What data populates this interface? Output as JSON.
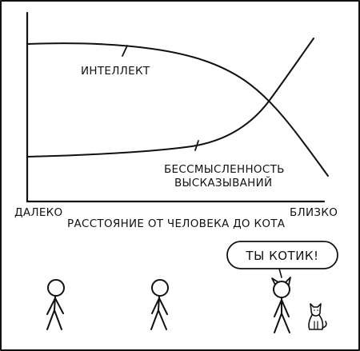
{
  "graph": {
    "curve_top_label": "ИНТЕЛЛЕКТ",
    "curve_bottom_label_line1": "БЕССМЫСЛЕННОСТЬ",
    "curve_bottom_label_line2": "ВЫСКАЗЫВАНИЙ",
    "x_axis_left": "ДАЛЕКО",
    "x_axis_right": "БЛИЗКО",
    "x_axis_title": "РАССТОЯНИЕ ОТ ЧЕЛОВЕКА ДО КОТА"
  },
  "scene": {
    "speech": "ТЫ КОТИК!",
    "figures": [
      "stick-figure",
      "stick-figure",
      "stick-figure",
      "cat"
    ]
  }
}
